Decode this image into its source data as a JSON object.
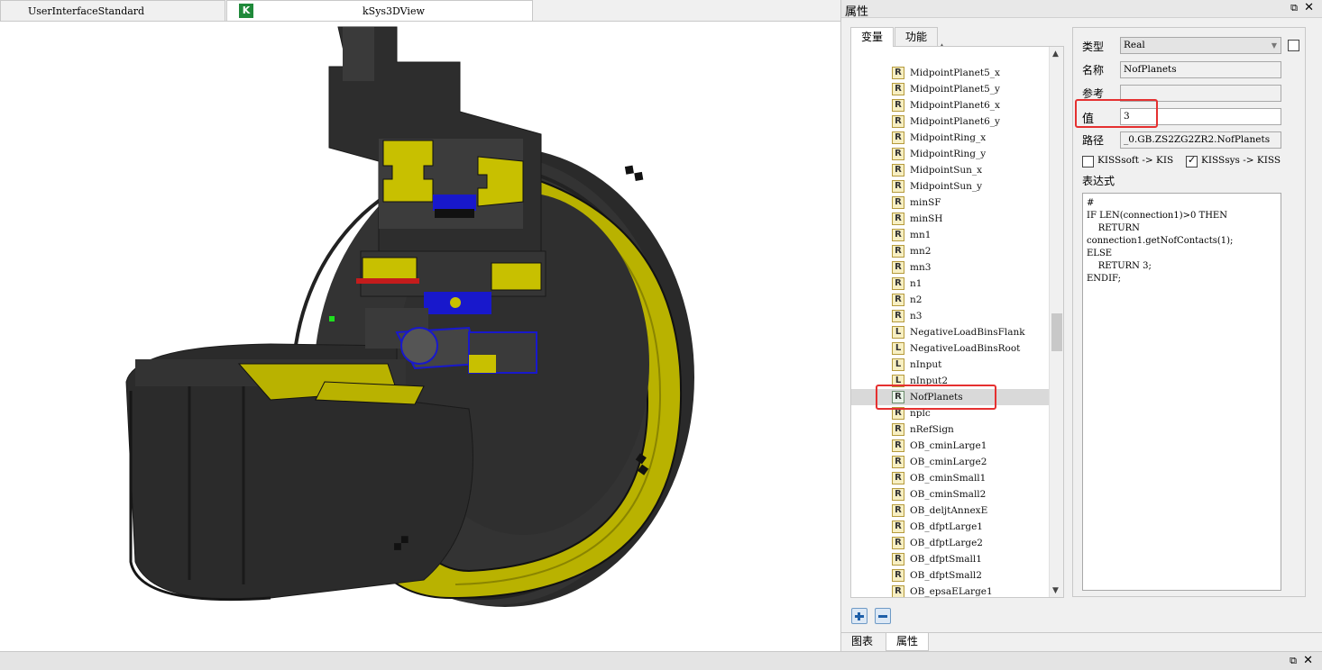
{
  "left_tabs": {
    "tab1_label": "UserInterfaceStandard",
    "tab2_label": "kSys3DView",
    "tab2_icon": "K"
  },
  "panel": {
    "title": "属性",
    "pin_glyph": "⧉",
    "close_glyph": "✕",
    "tabs": {
      "variables": "变量",
      "functions": "功能"
    },
    "tree_items": [
      {
        "badge": "R",
        "name": "MidpointPlanet5_x"
      },
      {
        "badge": "R",
        "name": "MidpointPlanet5_y"
      },
      {
        "badge": "R",
        "name": "MidpointPlanet6_x"
      },
      {
        "badge": "R",
        "name": "MidpointPlanet6_y"
      },
      {
        "badge": "R",
        "name": "MidpointRing_x"
      },
      {
        "badge": "R",
        "name": "MidpointRing_y"
      },
      {
        "badge": "R",
        "name": "MidpointSun_x"
      },
      {
        "badge": "R",
        "name": "MidpointSun_y"
      },
      {
        "badge": "R",
        "name": "minSF"
      },
      {
        "badge": "R",
        "name": "minSH"
      },
      {
        "badge": "R",
        "name": "mn1"
      },
      {
        "badge": "R",
        "name": "mn2"
      },
      {
        "badge": "R",
        "name": "mn3"
      },
      {
        "badge": "R",
        "name": "n1"
      },
      {
        "badge": "R",
        "name": "n2"
      },
      {
        "badge": "R",
        "name": "n3"
      },
      {
        "badge": "L",
        "name": "NegativeLoadBinsFlank"
      },
      {
        "badge": "L",
        "name": "NegativeLoadBinsRoot"
      },
      {
        "badge": "L",
        "name": "nInput"
      },
      {
        "badge": "L",
        "name": "nInput2"
      },
      {
        "badge": "R",
        "name": "NofPlanets",
        "selected": true
      },
      {
        "badge": "R",
        "name": "nplc"
      },
      {
        "badge": "R",
        "name": "nRefSign"
      },
      {
        "badge": "R",
        "name": "OB_cminLarge1"
      },
      {
        "badge": "R",
        "name": "OB_cminLarge2"
      },
      {
        "badge": "R",
        "name": "OB_cminSmall1"
      },
      {
        "badge": "R",
        "name": "OB_cminSmall2"
      },
      {
        "badge": "R",
        "name": "OB_deljtAnnexE"
      },
      {
        "badge": "R",
        "name": "OB_dfptLarge1"
      },
      {
        "badge": "R",
        "name": "OB_dfptLarge2"
      },
      {
        "badge": "R",
        "name": "OB_dfptSmall1"
      },
      {
        "badge": "R",
        "name": "OB_dfptSmall2"
      },
      {
        "badge": "R",
        "name": "OB_epsaELarge1"
      }
    ],
    "bottom_tabs": {
      "chart": "图表",
      "properties": "属性"
    }
  },
  "properties": {
    "type_label": "类型",
    "type_value": "Real",
    "name_label": "名称",
    "name_value": "NofPlanets",
    "ref_label": "参考",
    "ref_value": "",
    "value_label": "值",
    "value_value": "3",
    "path_label": "路径",
    "path_value": "_0.GB.ZS2ZG2ZR2.NofPlanets",
    "check1_label": "KISSsoft -> KIS",
    "check2_label": "KISSsys -> KISS",
    "expr_label": "表达式",
    "expression": "#\nIF LEN(connection1)>0 THEN\n    RETURN\nconnection1.getNofContacts(1);\nELSE\n    RETURN 3;\nENDIF;"
  },
  "colors": {
    "highlight": "#e53030",
    "selection": "#d9d9d9",
    "model_dark": "#2b2b2b",
    "model_yellow": "#b5ad00",
    "model_blue": "#1a1ad0"
  }
}
